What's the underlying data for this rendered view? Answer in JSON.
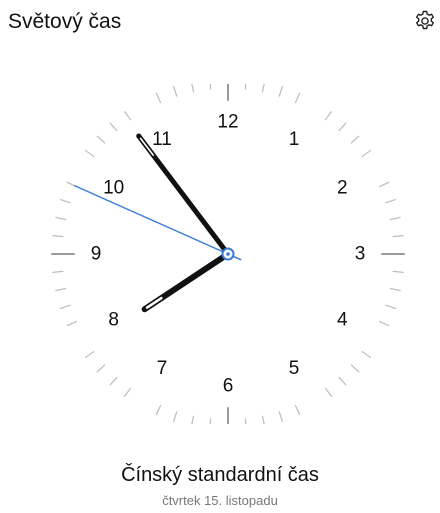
{
  "header": {
    "title": "Světový čas",
    "settings_icon": "gear-icon"
  },
  "clock": {
    "numerals": [
      "12",
      "1",
      "2",
      "3",
      "4",
      "5",
      "6",
      "7",
      "8",
      "9",
      "10",
      "11"
    ],
    "time": {
      "hour": 7,
      "minute": 53,
      "second": 49
    },
    "colors": {
      "hands": "#111111",
      "second_hand": "#3b7bd6",
      "ticks": "#bbbbbb",
      "major_ticks": "#9a9a9a"
    }
  },
  "location": {
    "city": "Čínský standardní čas",
    "date": "čtvrtek 15. listopadu"
  }
}
